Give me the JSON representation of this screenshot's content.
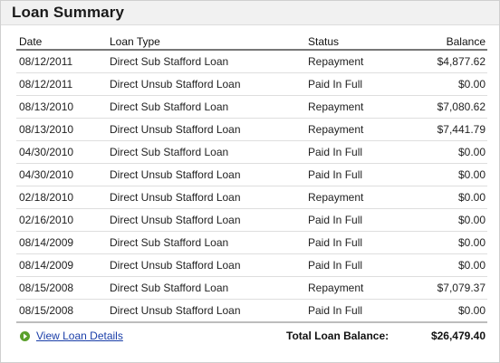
{
  "panel": {
    "title": "Loan Summary"
  },
  "table": {
    "headers": {
      "date": "Date",
      "type": "Loan Type",
      "status": "Status",
      "balance": "Balance"
    },
    "rows": [
      {
        "date": "08/12/2011",
        "type": "Direct Sub Stafford Loan",
        "status": "Repayment",
        "balance": "$4,877.62"
      },
      {
        "date": "08/12/2011",
        "type": "Direct Unsub Stafford Loan",
        "status": "Paid In Full",
        "balance": "$0.00"
      },
      {
        "date": "08/13/2010",
        "type": "Direct Sub Stafford Loan",
        "status": "Repayment",
        "balance": "$7,080.62"
      },
      {
        "date": "08/13/2010",
        "type": "Direct Unsub Stafford Loan",
        "status": "Repayment",
        "balance": "$7,441.79"
      },
      {
        "date": "04/30/2010",
        "type": "Direct Sub Stafford Loan",
        "status": "Paid In Full",
        "balance": "$0.00"
      },
      {
        "date": "04/30/2010",
        "type": "Direct Unsub Stafford Loan",
        "status": "Paid In Full",
        "balance": "$0.00"
      },
      {
        "date": "02/18/2010",
        "type": "Direct Unsub Stafford Loan",
        "status": "Repayment",
        "balance": "$0.00"
      },
      {
        "date": "02/16/2010",
        "type": "Direct Unsub Stafford Loan",
        "status": "Paid In Full",
        "balance": "$0.00"
      },
      {
        "date": "08/14/2009",
        "type": "Direct Sub Stafford Loan",
        "status": "Paid In Full",
        "balance": "$0.00"
      },
      {
        "date": "08/14/2009",
        "type": "Direct Unsub Stafford Loan",
        "status": "Paid In Full",
        "balance": "$0.00"
      },
      {
        "date": "08/15/2008",
        "type": "Direct Sub Stafford Loan",
        "status": "Repayment",
        "balance": "$7,079.37"
      },
      {
        "date": "08/15/2008",
        "type": "Direct Unsub Stafford Loan",
        "status": "Paid In Full",
        "balance": "$0.00"
      }
    ]
  },
  "footer": {
    "details_link_label": "View Loan Details",
    "details_icon": "green-circle-arrow-icon",
    "total_label": "Total Loan Balance:",
    "total_value": "$26,479.40"
  },
  "colors": {
    "header_background": "#f1f1f1",
    "link": "#1a3ea8",
    "icon_green": "#5aa02c"
  }
}
